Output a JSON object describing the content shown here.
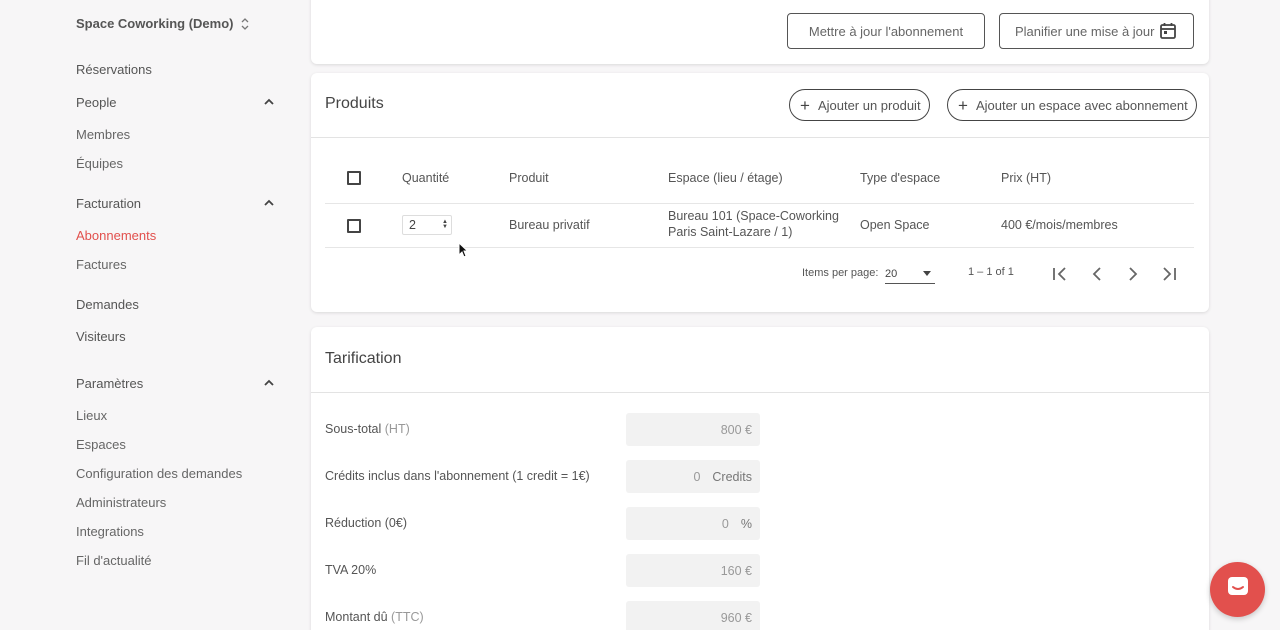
{
  "sidebar": {
    "workspace": "Space Coworking (Demo)",
    "items": {
      "reservations": "Réservations",
      "people": "People",
      "membres": "Membres",
      "equipes": "Équipes",
      "facturation": "Facturation",
      "abonnements": "Abonnements",
      "factures": "Factures",
      "demandes": "Demandes",
      "visiteurs": "Visiteurs",
      "parametres": "Paramètres",
      "lieux": "Lieux",
      "espaces": "Espaces",
      "config_demandes": "Configuration des demandes",
      "administrateurs": "Administrateurs",
      "integrations": "Integrations",
      "fil": "Fil d'actualité"
    }
  },
  "top": {
    "update_button": "Mettre à jour l'abonnement",
    "schedule_placeholder": "Planifier une mise à jour"
  },
  "products": {
    "title": "Produits",
    "add_product": "Ajouter un produit",
    "add_space": "Ajouter un espace avec abonnement",
    "columns": [
      "Quantité",
      "Produit",
      "Espace (lieu / étage)",
      "Type d'espace",
      "Prix (HT)"
    ],
    "row": {
      "quantity": "2",
      "product": "Bureau privatif",
      "space_line1": "Bureau 101 (Space-Coworking",
      "space_line2": "Paris Saint-Lazare / 1)",
      "type": "Open Space",
      "price": "400 €/mois/membres"
    },
    "pager": {
      "items_per_page_label": "Items per page:",
      "items_per_page": "20",
      "range": "1 – 1 of 1"
    }
  },
  "pricing": {
    "title": "Tarification",
    "subtotal_label": "Sous-total",
    "subtotal_suffix": "(HT)",
    "subtotal_value": "800 €",
    "credits_label": "Crédits inclus dans l'abonnement (1 credit = 1€)",
    "credits_value": "0",
    "credits_unit": "Credits",
    "discount_label": "Réduction (0€)",
    "discount_value": "0",
    "discount_unit": "%",
    "vat_label": "TVA 20%",
    "vat_value": "160 €",
    "total_label": "Montant dû",
    "total_suffix": "(TTC)",
    "total_value": "960 €"
  },
  "colors": {
    "accent": "#e2504d",
    "background": "#f7f6f7"
  }
}
